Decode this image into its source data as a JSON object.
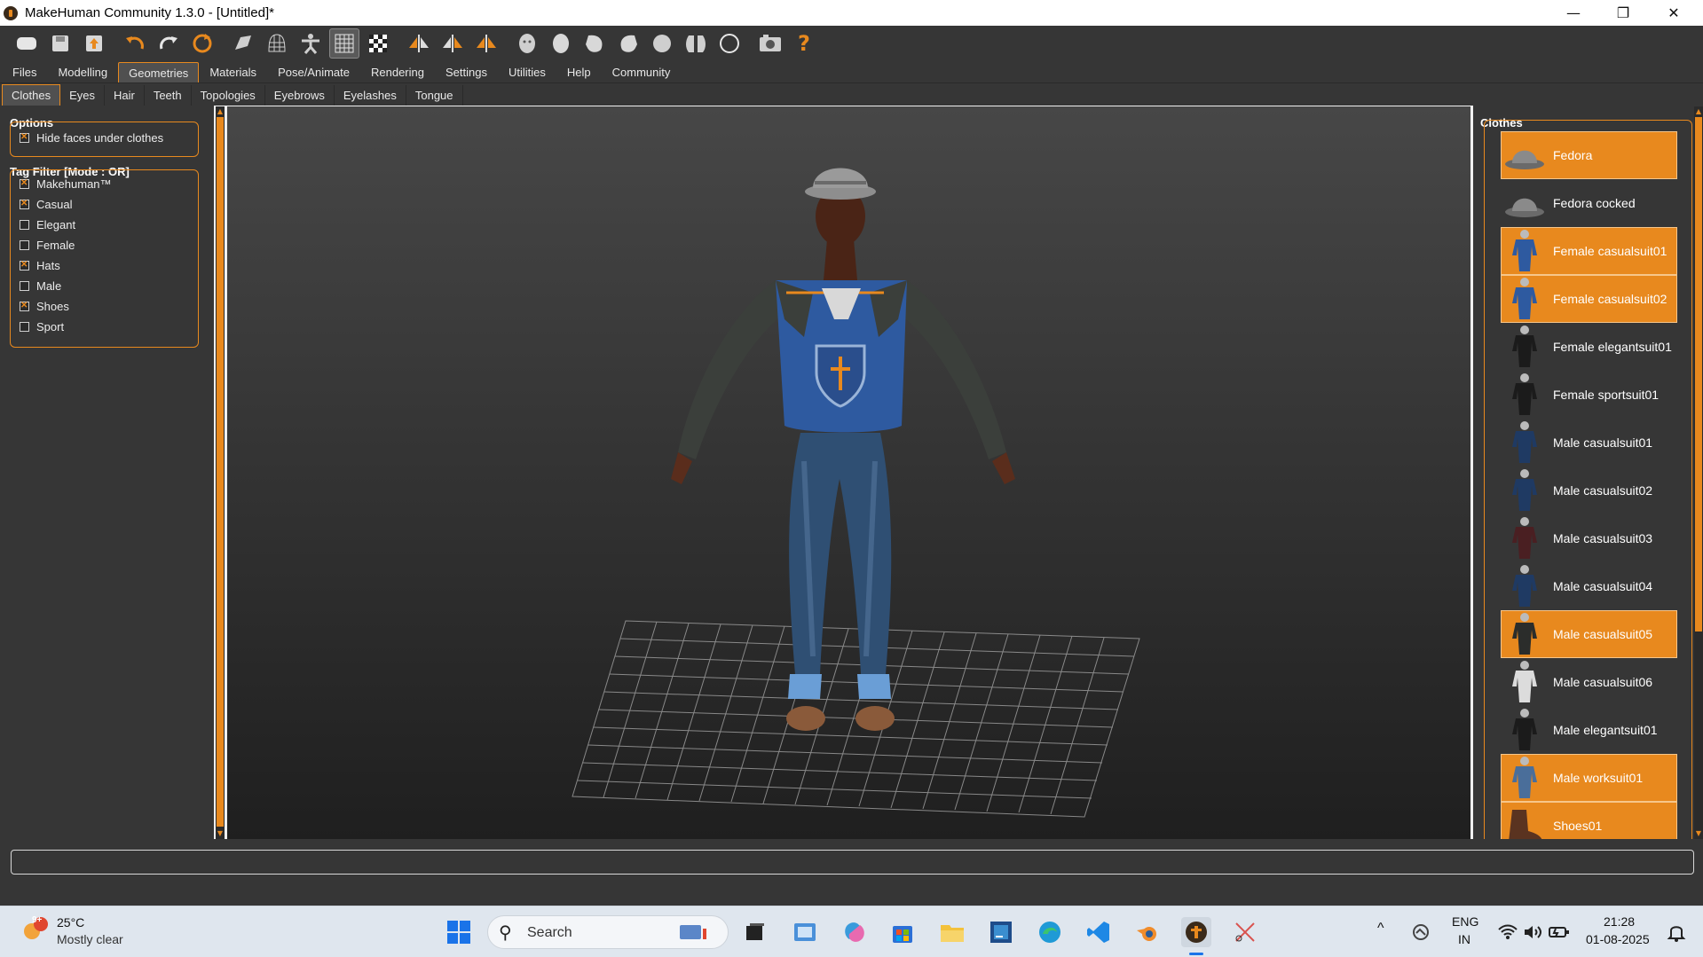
{
  "window": {
    "title": "MakeHuman Community 1.3.0 - [Untitled]*",
    "minimize": "—",
    "maximize": "❐",
    "close": "✕"
  },
  "toolbar": {
    "icons": [
      "new-file-icon",
      "save-icon",
      "export-icon",
      "undo-icon",
      "redo-icon",
      "reset-icon",
      "smooth-icon",
      "wireframe-icon",
      "pose-icon",
      "grid-icon",
      "checker-icon",
      "symmetry-right-icon",
      "symmetry-left-icon",
      "symmetry-icon",
      "front-view-icon",
      "back-view-icon",
      "left-view-icon",
      "right-view-icon",
      "top-view-icon",
      "bottom-view-icon",
      "reset-camera-icon",
      "screenshot-icon",
      "help-icon"
    ]
  },
  "tabs": [
    "Files",
    "Modelling",
    "Geometries",
    "Materials",
    "Pose/Animate",
    "Rendering",
    "Settings",
    "Utilities",
    "Help",
    "Community"
  ],
  "active_tab": "Geometries",
  "subtabs": [
    "Clothes",
    "Eyes",
    "Hair",
    "Teeth",
    "Topologies",
    "Eyebrows",
    "Eyelashes",
    "Tongue"
  ],
  "active_subtab": "Clothes",
  "options": {
    "title": "Options",
    "hide_faces": {
      "label": "Hide faces under clothes",
      "checked": true
    }
  },
  "tag_filter": {
    "title": "Tag Filter [Mode : OR]",
    "tags": [
      {
        "label": "Makehuman™",
        "checked": true
      },
      {
        "label": "Casual",
        "checked": true
      },
      {
        "label": "Elegant",
        "checked": false
      },
      {
        "label": "Female",
        "checked": false
      },
      {
        "label": "Hats",
        "checked": true
      },
      {
        "label": "Male",
        "checked": false
      },
      {
        "label": "Shoes",
        "checked": true
      },
      {
        "label": "Sport",
        "checked": false
      }
    ]
  },
  "clothes": {
    "title": "Clothes",
    "items": [
      {
        "label": "Fedora",
        "selected": true,
        "thumb": "hat"
      },
      {
        "label": "Fedora cocked",
        "selected": false,
        "thumb": "hat"
      },
      {
        "label": "Female casualsuit01",
        "selected": true,
        "thumb": "suit-blue"
      },
      {
        "label": "Female casualsuit02",
        "selected": true,
        "thumb": "suit-blue"
      },
      {
        "label": "Female elegantsuit01",
        "selected": false,
        "thumb": "suit-black"
      },
      {
        "label": "Female sportsuit01",
        "selected": false,
        "thumb": "suit-black"
      },
      {
        "label": "Male casualsuit01",
        "selected": false,
        "thumb": "suit-navy"
      },
      {
        "label": "Male casualsuit02",
        "selected": false,
        "thumb": "suit-navy"
      },
      {
        "label": "Male casualsuit03",
        "selected": false,
        "thumb": "suit-maroon"
      },
      {
        "label": "Male casualsuit04",
        "selected": false,
        "thumb": "suit-navy"
      },
      {
        "label": "Male casualsuit05",
        "selected": true,
        "thumb": "suit-dark"
      },
      {
        "label": "Male casualsuit06",
        "selected": false,
        "thumb": "suit-white"
      },
      {
        "label": "Male elegantsuit01",
        "selected": false,
        "thumb": "suit-black"
      },
      {
        "label": "Male worksuit01",
        "selected": true,
        "thumb": "suit-overall"
      },
      {
        "label": "Shoes01",
        "selected": true,
        "thumb": "shoe"
      }
    ]
  },
  "taskbar": {
    "weather_temp": "25°C",
    "weather_desc": "Mostly clear",
    "weather_badge": "9+",
    "search_placeholder": "Search",
    "lang_top": "ENG",
    "lang_bottom": "IN",
    "time": "21:28",
    "date": "01-08-2025",
    "tray_chevron": "^"
  },
  "colors": {
    "accent": "#e8891e",
    "panel": "#363636"
  }
}
